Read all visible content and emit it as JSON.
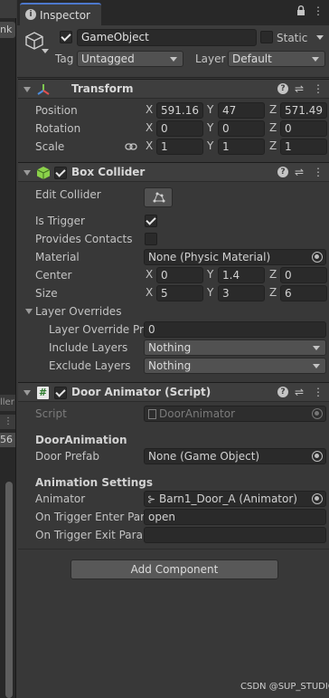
{
  "left_strip": {
    "top_label": "nk",
    "mid_label": "ller",
    "num_label": "56"
  },
  "tab": {
    "title": "Inspector"
  },
  "gameobject": {
    "name": "GameObject",
    "static_label": "Static",
    "tag_label": "Tag",
    "tag_value": "Untagged",
    "layer_label": "Layer",
    "layer_value": "Default"
  },
  "transform": {
    "title": "Transform",
    "position": {
      "label": "Position",
      "x": "591.16",
      "y": "47",
      "z": "571.49"
    },
    "rotation": {
      "label": "Rotation",
      "x": "0",
      "y": "0",
      "z": "0"
    },
    "scale": {
      "label": "Scale",
      "x": "1",
      "y": "1",
      "z": "1"
    },
    "axis": {
      "x": "X",
      "y": "Y",
      "z": "Z"
    }
  },
  "box_collider": {
    "title": "Box Collider",
    "edit_collider": "Edit Collider",
    "is_trigger": "Is Trigger",
    "provides_contacts": "Provides Contacts",
    "material_label": "Material",
    "material_value": "None (Physic Material)",
    "center": {
      "label": "Center",
      "x": "0",
      "y": "1.4",
      "z": "0"
    },
    "size": {
      "label": "Size",
      "x": "5",
      "y": "3",
      "z": "6"
    },
    "layer_overrides": "Layer Overrides",
    "layer_override_priority_label": "Layer Override Prio",
    "layer_override_priority_value": "0",
    "include_layers_label": "Include Layers",
    "include_layers_value": "Nothing",
    "exclude_layers_label": "Exclude Layers",
    "exclude_layers_value": "Nothing"
  },
  "door_animator": {
    "title": "Door Animator (Script)",
    "script_label": "Script",
    "script_value": "DoorAnimator",
    "section1": "DoorAnimation",
    "door_prefab_label": "Door Prefab",
    "door_prefab_value": "None (Game Object)",
    "section2": "Animation Settings",
    "animator_label": "Animator",
    "animator_value": "Barn1_Door_A (Animator)",
    "enter_label": "On Trigger Enter Para",
    "enter_value": "open",
    "exit_label": "On Trigger Exit Param",
    "exit_value": ""
  },
  "add_component": "Add Component",
  "watermark": "CSDN @SUP_STUDIO"
}
